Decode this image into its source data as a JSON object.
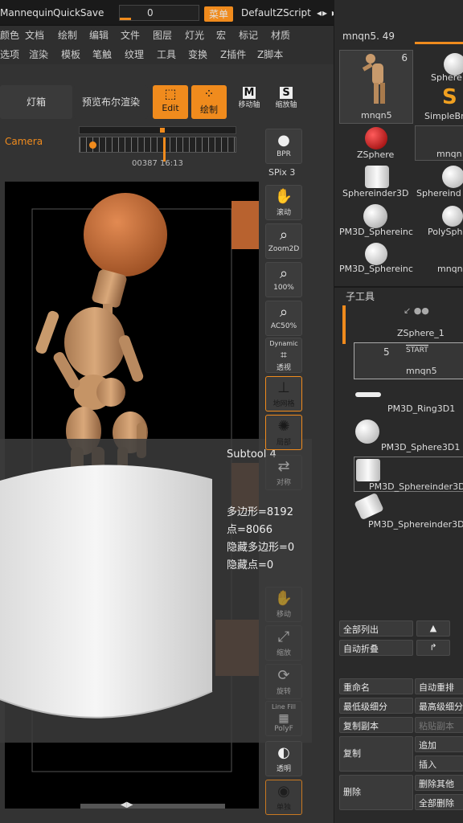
{
  "topbar": {
    "app_name": "Mannequin",
    "quicksave": "QuickSave",
    "transparency_label": "透视",
    "transparency_value": "0",
    "menu_button": "菜单",
    "script_name": "DefaultZScript"
  },
  "menus": {
    "row1": [
      "颜色",
      "文档",
      "绘制",
      "编辑",
      "文件",
      "图层",
      "灯光",
      "宏",
      "标记",
      "材质"
    ],
    "row2": [
      "选项",
      "渲染",
      "模板",
      "笔触",
      "纹理",
      "工具",
      "变换",
      "Z插件",
      "Z脚本"
    ]
  },
  "toolbar": {
    "lightbox": "灯箱",
    "bpr_preview": "预览布尔渲染",
    "edit": "Edit",
    "draw": "绘制",
    "move_label": "移动轴",
    "scale_label": "缩放轴",
    "camera": "Camera",
    "timeline_readout": "00387 16:13"
  },
  "side_buttons": {
    "bpr": "BPR",
    "spix": "SPix 3",
    "scroll": "滚动",
    "zoom2d": "Zoom2D",
    "zoom100": "100%",
    "ac50": "AC50%",
    "dynamic": "Dynamic",
    "perspective": "透视",
    "floor": "地网格",
    "local": "局部",
    "frame": "对称",
    "move": "移动",
    "scale": "缩放",
    "rotate": "旋转",
    "linefill": "Line Fill",
    "polyf": "PolyF",
    "transp": "透明",
    "solo": "单独"
  },
  "subtool_info": {
    "title": "Subtool 4",
    "polys": "多边形=8192",
    "points": "点=8066",
    "hidden_polys": "隐藏多边形=0",
    "hidden_points": "隐藏点=0"
  },
  "tool_palette": {
    "current_tool": "mnqn5. 49",
    "count": "6",
    "tiles": [
      "mnqn5",
      "Sphere",
      "SimpleBr",
      "ZSphere",
      "mnqn",
      "Sphereinder3D",
      "Sphereind",
      "PM3D_Sphereinc",
      "PolySph",
      "PM3D_Sphereinc",
      "mnqn"
    ]
  },
  "subtool_palette": {
    "title": "子工具",
    "items": [
      "ZSphere_1",
      "mnqn5",
      "PM3D_Ring3D1",
      "PM3D_Sphere3D1",
      "PM3D_Sphereinder3D",
      "PM3D_Sphereinder3D"
    ],
    "start_label": "START",
    "count": "5"
  },
  "actions": {
    "list_all": "全部列出",
    "auto_collapse": "自动折叠",
    "rename": "重命名",
    "auto_reorder": "自动重排",
    "lowest_subdiv": "最低级细分",
    "highest_subdiv": "最高级细分",
    "duplicate": "复制副本",
    "paste": "粘贴副本",
    "copy": "复制",
    "append": "追加",
    "insert": "插入",
    "delete": "删除",
    "delete_other": "删除其他",
    "delete_all": "全部删除"
  },
  "colors": {
    "accent": "#f08b1d"
  }
}
